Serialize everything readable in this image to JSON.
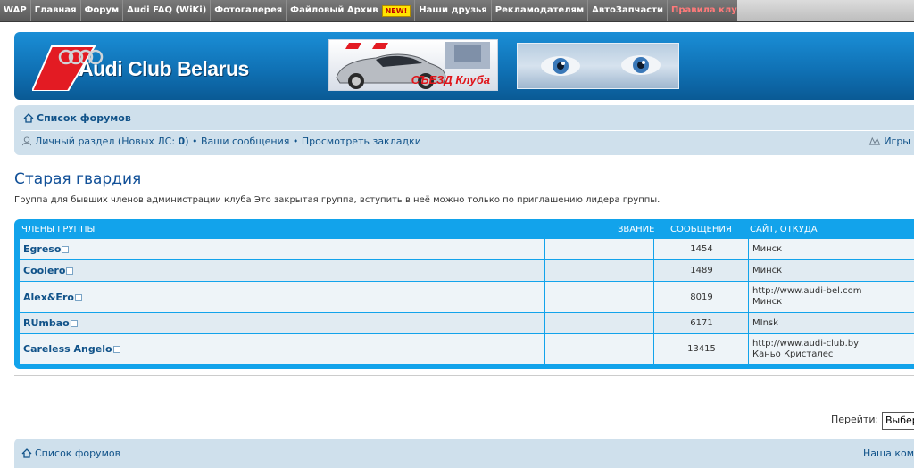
{
  "topnav": {
    "items": [
      "WAP",
      "Главная",
      "Форум",
      "Audi FAQ (WiKi)",
      "Фотогалерея",
      "Файловый Архив",
      "Наши друзья",
      "Рекламодателям",
      "АвтоЗапчасти",
      "Правила клуба"
    ],
    "new_badge": "NEW!"
  },
  "header": {
    "logo_text": "Audi Club Belarus",
    "banner_text": "СЪЕЗД Клуба",
    "brand_color": "#0f6fb2"
  },
  "breadcrumb": {
    "forum_index": "Список форумов",
    "personal": "Личный раздел (Новых ЛС: ",
    "new_pm_count": "0",
    "personal_close": ")",
    "your_posts": "Ваши сообщения",
    "bookmarks": "Просмотреть закладки",
    "games": "Игры"
  },
  "group": {
    "title": "Старая гвардия",
    "description": "Группа для бывших членов администрации клуба Это закрытая группа, вступить в неё можно только по приглашению лидера группы."
  },
  "table": {
    "headers": {
      "members": "Члены группы",
      "rank": "Звание",
      "posts": "Сообщения",
      "site": "Сайт, откуда"
    },
    "rows": [
      {
        "name": "Egreso",
        "posts": "1454",
        "site": "",
        "location": "Минск"
      },
      {
        "name": "Coolero",
        "posts": "1489",
        "site": "",
        "location": "Минск"
      },
      {
        "name": "Alex&Ero",
        "posts": "8019",
        "site": "http://www.audi-bel.com",
        "location": "Минск"
      },
      {
        "name": "RUmbao",
        "posts": "6171",
        "site": "",
        "location": "MInsk"
      },
      {
        "name": "Careless Angelo",
        "posts": "13415",
        "site": "http://www.audi-club.by",
        "location": "Каньо Кристалес"
      }
    ]
  },
  "jump": {
    "label": "Перейти:",
    "selected": "Выбер"
  },
  "footer": {
    "forum_index": "Список форумов",
    "right_text": "Наша ком"
  }
}
